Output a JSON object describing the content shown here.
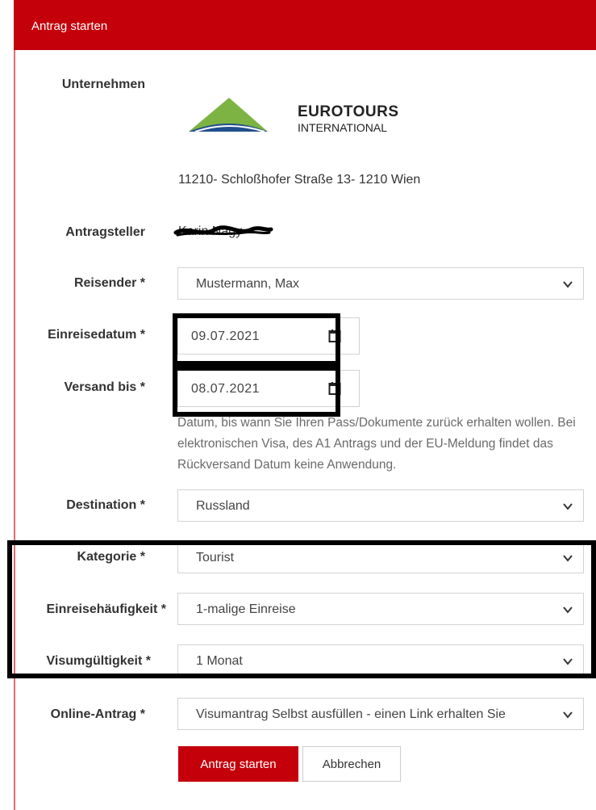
{
  "header": {
    "title": "Antrag starten"
  },
  "company": {
    "label": "Unternehmen",
    "logo_line1": "EUROTOURS",
    "logo_line2": "INTERNATIONAL",
    "address": "11210- Schloßhofer Straße 13- 1210 Wien"
  },
  "applicant": {
    "label": "Antragsteller",
    "value": "Karin Nagy"
  },
  "fields": {
    "traveler": {
      "label": "Reisender *",
      "value": "Mustermann, Max"
    },
    "entry_date": {
      "label": "Einreisedatum *",
      "value": "09.07.2021"
    },
    "ship_until": {
      "label": "Versand bis *",
      "value": "08.07.2021",
      "help": "Datum, bis wann Sie Ihren Pass/Dokumente zurück erhalten wollen. Bei elektronischen Visa, des A1 Antrags und der EU-Meldung findet das Rückversand Datum keine Anwendung."
    },
    "destination": {
      "label": "Destination *",
      "value": "Russland"
    },
    "category": {
      "label": "Kategorie *",
      "value": "Tourist"
    },
    "entry_frequency": {
      "label": "Einreisehäufigkeit *",
      "value": "1-malige Einreise"
    },
    "visa_validity": {
      "label": "Visumgültigkeit *",
      "value": "1 Monat"
    },
    "online_application": {
      "label": "Online-Antrag *",
      "value": "Visumantrag Selbst ausfüllen - einen Link erhalten Sie"
    }
  },
  "buttons": {
    "submit": "Antrag starten",
    "cancel": "Abbrechen"
  },
  "colors": {
    "brand_red": "#c4010b",
    "logo_green": "#7cb342",
    "logo_blue": "#1f4e8c"
  },
  "icons": {
    "select_arrow": "chevron-down-icon",
    "date_picker": "calendar-icon"
  }
}
